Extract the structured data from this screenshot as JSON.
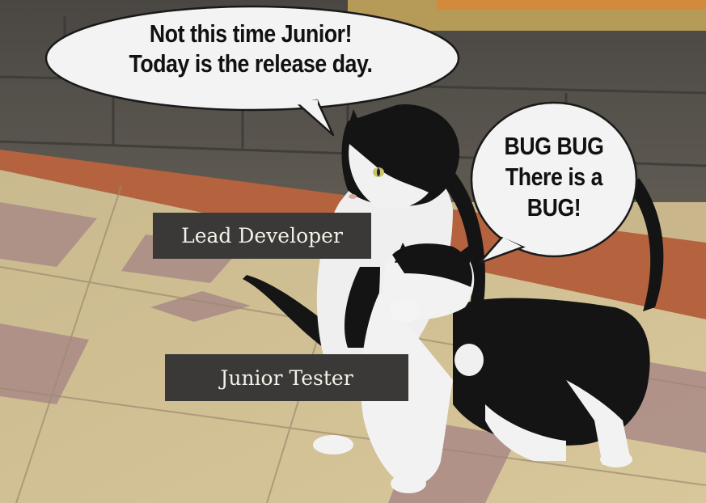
{
  "speech_bubbles": {
    "lead_line1": "Not this time Junior!",
    "lead_line2": "Today is the release day.",
    "junior_line1": "BUG BUG",
    "junior_line2": "There is a",
    "junior_line3": "BUG!"
  },
  "labels": {
    "lead": "Lead Developer",
    "junior": "Junior Tester"
  },
  "colors": {
    "label_background": "#3a3937",
    "label_text": "#f4f0e8",
    "bubble_fill": "#f3f3f3",
    "bubble_text": "#111111"
  }
}
